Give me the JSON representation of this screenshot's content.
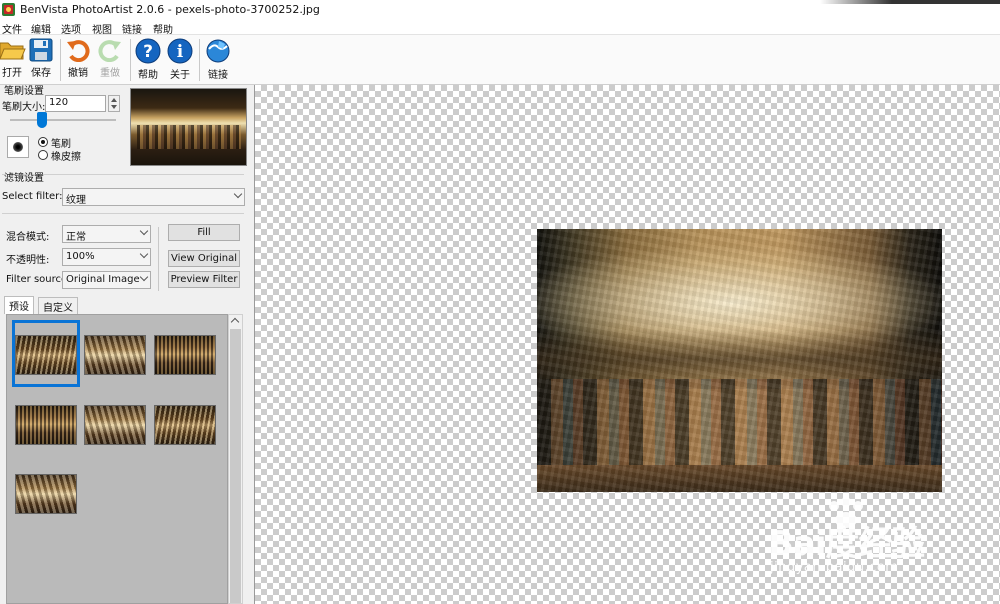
{
  "window": {
    "title": "BenVista PhotoArtist 2.0.6 - pexels-photo-3700252.jpg"
  },
  "menu": [
    "文件",
    "编辑",
    "选项",
    "视图",
    "链接",
    "帮助"
  ],
  "toolbar": {
    "open": "打开",
    "save": "保存",
    "undo": "撤销",
    "redo": "重做",
    "help": "帮助",
    "about": "关于",
    "link": "链接"
  },
  "brush_settings": {
    "section_title": "笔刷设置",
    "size_label": "笔刷大小:",
    "size_value": "120",
    "mode_brush": "笔刷",
    "mode_eraser": "橡皮擦",
    "selected_mode": "brush"
  },
  "filter_settings": {
    "section_title": "滤镜设置",
    "select_filter_label": "Select filter:",
    "select_filter_value": "纹理",
    "blend_mode_label": "混合模式:",
    "blend_mode_value": "正常",
    "opacity_label": "不透明性:",
    "opacity_value": "100%",
    "filter_source_label": "Filter source:",
    "filter_source_value": "Original Image",
    "fill_button": "Fill",
    "view_original_button": "View Original",
    "preview_filter_button": "Preview Filter"
  },
  "tabs": {
    "presets": "预设",
    "custom": "自定义",
    "active": "presets"
  },
  "presets": {
    "count": 7,
    "selected_index": 0
  },
  "colors": {
    "accent": "#0078d7",
    "selection": "#0a74d6"
  },
  "watermark": {
    "brand": "Bai度经验",
    "sub": "jingyan.baidu.com"
  }
}
